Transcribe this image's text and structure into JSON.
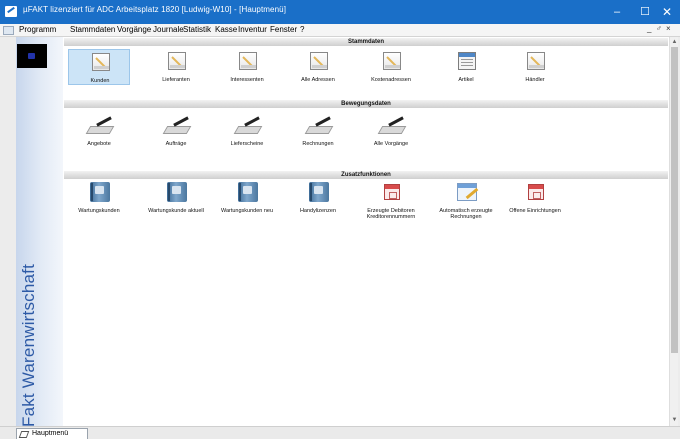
{
  "window": {
    "title": "µFAKT lizenziert für ADC    Arbeitsplatz 1820 [Ludwig-W10]        - [Hauptmenü]",
    "min_glyph": "–",
    "max_glyph": "☐",
    "close_glyph": "✕"
  },
  "menubar": {
    "items": [
      "Programm",
      "Stammdaten",
      "Vorgänge",
      "Journale",
      "Statistik",
      "Kasse",
      "Inventur",
      "Fenster",
      "?"
    ],
    "mdi_controls": [
      "_",
      "♂",
      "×"
    ]
  },
  "sidepanel": {
    "vertical_text": "µFakt Warenwirtschaft"
  },
  "sections": {
    "stammdaten": {
      "title": "Stammdaten",
      "tiles": [
        {
          "label": "Kunden",
          "icon": "document-pen-icon",
          "selected": true
        },
        {
          "label": "Lieferanten",
          "icon": "document-pen-icon"
        },
        {
          "label": "Interessenten",
          "icon": "document-pen-icon"
        },
        {
          "label": "Alle Adressen",
          "icon": "document-pen-icon"
        },
        {
          "label": "Kostenadressen",
          "icon": "document-pen-icon"
        },
        {
          "label": "Artikel",
          "icon": "window-form-icon"
        },
        {
          "label": "Händler",
          "icon": "document-pen-icon"
        }
      ]
    },
    "bewegungsdaten": {
      "title": "Bewegungsdaten",
      "tiles": [
        {
          "label": "Angebote",
          "icon": "writing-pen-icon"
        },
        {
          "label": "Aufträge",
          "icon": "writing-pen-icon"
        },
        {
          "label": "Lieferscheine",
          "icon": "writing-pen-icon"
        },
        {
          "label": "Rechnungen",
          "icon": "writing-pen-icon"
        },
        {
          "label": "Alle Vorgänge",
          "icon": "writing-pen-sum-icon"
        }
      ]
    },
    "zusatzfunktionen": {
      "title": "Zusatzfunktionen",
      "tiles": [
        {
          "label": "Wartungskunden",
          "icon": "binder-icon"
        },
        {
          "label": "Wartungskunde aktuell",
          "icon": "binder-icon"
        },
        {
          "label": "Wartungskunden neu",
          "icon": "binder-icon"
        },
        {
          "label": "Handylizenzen",
          "icon": "binder-icon"
        },
        {
          "label": "Erzeugte Debitoren Kreditorennummern",
          "icon": "calendar-icon"
        },
        {
          "label": "Automatisch erzeugte Rechnungen",
          "icon": "sheet-pen-icon"
        },
        {
          "label": "Offene Einrichtungen",
          "icon": "calendar-icon"
        }
      ]
    }
  },
  "taskbar": {
    "tab_label": "Hauptmenü"
  },
  "colors": {
    "titlebar": "#1a6fc8",
    "selected_tile": "#cce4f7",
    "side_text": "#2d5aa6"
  }
}
